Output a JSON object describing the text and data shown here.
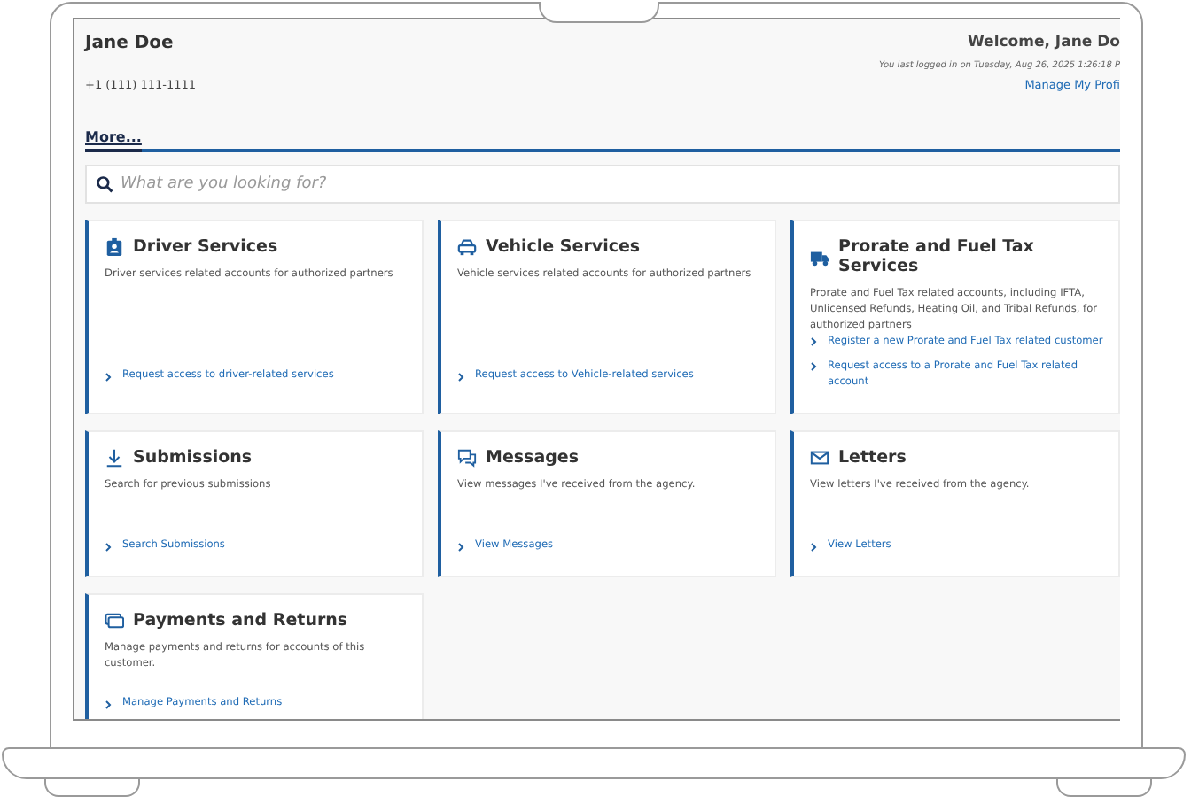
{
  "user": {
    "name": "Jane Doe",
    "phone": "+1 (111) 111-1111",
    "welcome": "Welcome, Jane Do",
    "last_login": "You last logged in on Tuesday, Aug 26, 2025 1:26:18 P",
    "profile_link": "Manage My Profi"
  },
  "tabs": [
    {
      "label": "More...",
      "selected": true
    }
  ],
  "search": {
    "placeholder": "What are you looking for?"
  },
  "cards": [
    {
      "title": "Driver Services",
      "description": "Driver services related accounts for authorized partners",
      "links": [
        "Request access to driver-related services"
      ]
    },
    {
      "title": "Vehicle Services",
      "description": "Vehicle services related accounts for authorized partners",
      "links": [
        "Request access to Vehicle-related services"
      ]
    },
    {
      "title": "Prorate and Fuel Tax Services",
      "description": "Prorate and Fuel Tax related accounts, including IFTA, Unlicensed Refunds, Heating Oil, and Tribal Refunds, for authorized partners",
      "links": [
        "Register a new Prorate and Fuel Tax related customer",
        "Request access to a Prorate and Fuel Tax related account"
      ]
    },
    {
      "title": "Submissions",
      "description": "Search for previous submissions",
      "links": [
        "Search Submissions"
      ]
    },
    {
      "title": "Messages",
      "description": "View messages I've received from the agency.",
      "links": [
        "View Messages"
      ]
    },
    {
      "title": "Letters",
      "description": "View letters I've received from the agency.",
      "links": [
        "View Letters"
      ]
    },
    {
      "title": "Payments and Returns",
      "description": "Manage payments and returns for accounts of this customer.",
      "links": [
        "Manage Payments and Returns"
      ]
    }
  ]
}
